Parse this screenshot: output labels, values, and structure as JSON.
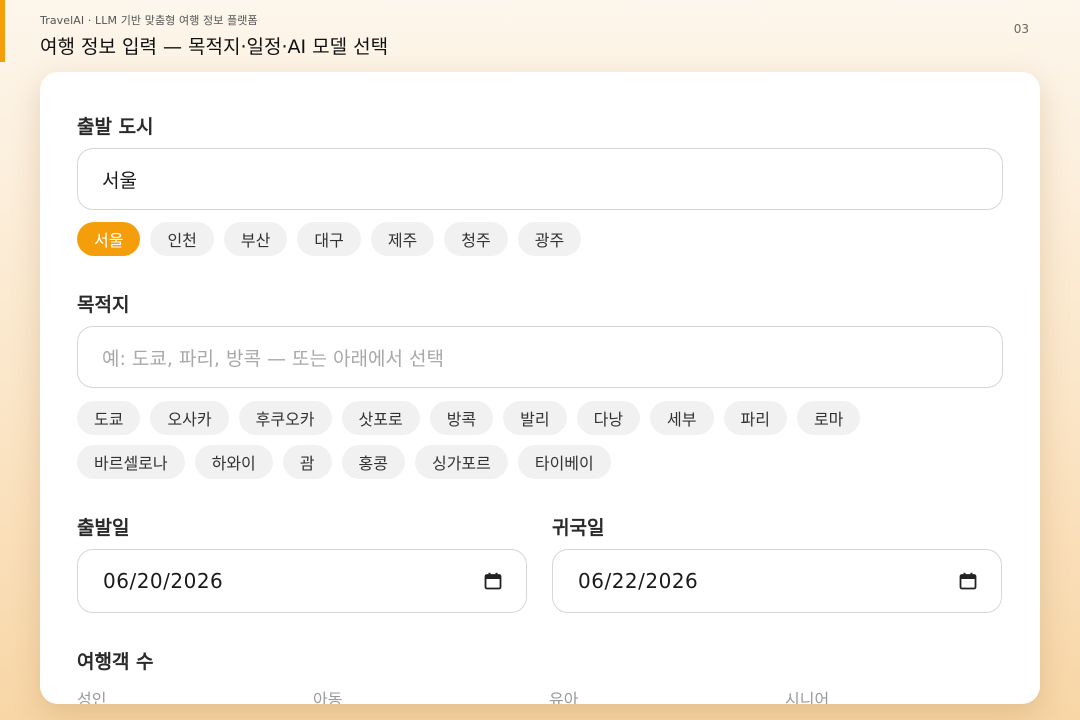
{
  "header": {
    "subtitle": "TravelAI · LLM 기반 맞춤형 여행 정보 플랫폼",
    "title": "여행 정보 입력 — 목적지·일정·AI 모델 선택",
    "page_number": "03"
  },
  "departure": {
    "label": "출발 도시",
    "value": "서울",
    "chips": [
      "서울",
      "인천",
      "부산",
      "대구",
      "제주",
      "청주",
      "광주"
    ],
    "selected": "서울"
  },
  "destination": {
    "label": "목적지",
    "placeholder": "예: 도쿄, 파리, 방콕 — 또는 아래에서 선택",
    "chips_row1": [
      "도쿄",
      "오사카",
      "후쿠오카",
      "삿포로",
      "방콕",
      "발리",
      "다낭",
      "세부",
      "파리",
      "로마"
    ],
    "chips_row2": [
      "바르셀로나",
      "하와이",
      "괌",
      "홍콩",
      "싱가포르",
      "타이베이"
    ]
  },
  "dates": {
    "depart_label": "출발일",
    "depart_value": "06/20/2026",
    "return_label": "귀국일",
    "return_value": "06/22/2026"
  },
  "travelers": {
    "label": "여행객 수",
    "types": [
      "성인",
      "아동",
      "유아",
      "시니어"
    ]
  },
  "colors": {
    "accent": "#f59e0b"
  }
}
